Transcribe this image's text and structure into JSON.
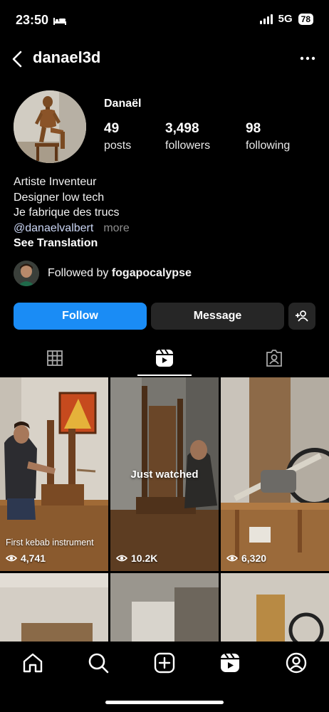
{
  "status_bar": {
    "time": "23:50",
    "network": "5G",
    "battery": "78"
  },
  "header": {
    "username": "danael3d"
  },
  "profile": {
    "display_name": "Danaël",
    "stats": [
      {
        "value": "49",
        "label": "posts"
      },
      {
        "value": "3,498",
        "label": "followers"
      },
      {
        "value": "98",
        "label": "following"
      }
    ],
    "bio_lines": [
      "Artiste Inventeur",
      "Designer low tech",
      "Je fabrique des trucs"
    ],
    "link": "@danaelvalbert",
    "more": "more",
    "see_translation": "See Translation",
    "followed_by_prefix": "Followed by ",
    "followed_by_user": "fogapocalypse"
  },
  "actions": {
    "follow": "Follow",
    "message": "Message"
  },
  "tabs": [
    "grid-icon",
    "reels-icon",
    "tagged-icon"
  ],
  "active_tab": "reels-icon",
  "reels": [
    {
      "caption": "First kebab instrument",
      "views": "4,741"
    },
    {
      "overlay": "Just watched",
      "views": "10.2K"
    },
    {
      "views": "6,320"
    }
  ],
  "bottom_nav": [
    "home-icon",
    "search-icon",
    "create-icon",
    "reels-icon",
    "profile-icon"
  ],
  "colors": {
    "accent": "#1a8cf5",
    "background": "#000000",
    "secondary_button": "#262626"
  }
}
